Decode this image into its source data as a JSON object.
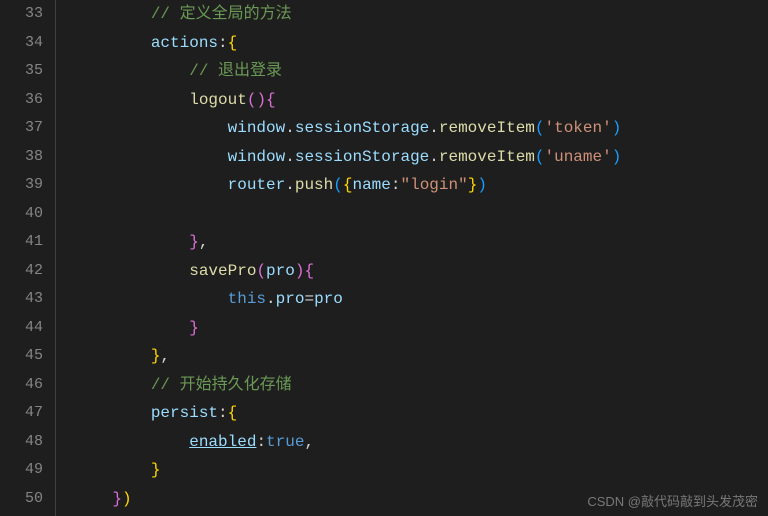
{
  "gutter": {
    "start": 33,
    "end": 50
  },
  "code": {
    "lines": [
      {
        "n": 33,
        "indent": "        ",
        "tokens": [
          {
            "t": "// 定义全局的方法",
            "c": "c-comment"
          }
        ]
      },
      {
        "n": 34,
        "indent": "        ",
        "tokens": [
          {
            "t": "actions",
            "c": "c-property"
          },
          {
            "t": ":",
            "c": "c-punct"
          },
          {
            "t": "{",
            "c": "c-brace"
          }
        ]
      },
      {
        "n": 35,
        "indent": "            ",
        "tokens": [
          {
            "t": "// 退出登录",
            "c": "c-comment"
          }
        ]
      },
      {
        "n": 36,
        "indent": "            ",
        "tokens": [
          {
            "t": "logout",
            "c": "c-function"
          },
          {
            "t": "(",
            "c": "c-brace2"
          },
          {
            "t": ")",
            "c": "c-brace2"
          },
          {
            "t": "{",
            "c": "c-brace2"
          }
        ]
      },
      {
        "n": 37,
        "indent": "                ",
        "tokens": [
          {
            "t": "window",
            "c": "c-variable"
          },
          {
            "t": ".",
            "c": "c-punct"
          },
          {
            "t": "sessionStorage",
            "c": "c-variable"
          },
          {
            "t": ".",
            "c": "c-punct"
          },
          {
            "t": "removeItem",
            "c": "c-function"
          },
          {
            "t": "(",
            "c": "c-brace3"
          },
          {
            "t": "'token'",
            "c": "c-string"
          },
          {
            "t": ")",
            "c": "c-brace3"
          }
        ]
      },
      {
        "n": 38,
        "indent": "                ",
        "tokens": [
          {
            "t": "window",
            "c": "c-variable"
          },
          {
            "t": ".",
            "c": "c-punct"
          },
          {
            "t": "sessionStorage",
            "c": "c-variable"
          },
          {
            "t": ".",
            "c": "c-punct"
          },
          {
            "t": "removeItem",
            "c": "c-function"
          },
          {
            "t": "(",
            "c": "c-brace3"
          },
          {
            "t": "'uname'",
            "c": "c-string"
          },
          {
            "t": ")",
            "c": "c-brace3"
          }
        ]
      },
      {
        "n": 39,
        "indent": "                ",
        "tokens": [
          {
            "t": "router",
            "c": "c-variable"
          },
          {
            "t": ".",
            "c": "c-punct"
          },
          {
            "t": "push",
            "c": "c-function"
          },
          {
            "t": "(",
            "c": "c-brace3"
          },
          {
            "t": "{",
            "c": "c-brace"
          },
          {
            "t": "name",
            "c": "c-property"
          },
          {
            "t": ":",
            "c": "c-punct"
          },
          {
            "t": "\"login\"",
            "c": "c-string"
          },
          {
            "t": "}",
            "c": "c-brace"
          },
          {
            "t": ")",
            "c": "c-brace3"
          }
        ]
      },
      {
        "n": 40,
        "indent": "",
        "tokens": []
      },
      {
        "n": 41,
        "indent": "            ",
        "tokens": [
          {
            "t": "}",
            "c": "c-brace2"
          },
          {
            "t": ",",
            "c": "c-punct"
          }
        ]
      },
      {
        "n": 42,
        "indent": "            ",
        "tokens": [
          {
            "t": "savePro",
            "c": "c-function"
          },
          {
            "t": "(",
            "c": "c-brace2"
          },
          {
            "t": "pro",
            "c": "c-variable"
          },
          {
            "t": ")",
            "c": "c-brace2"
          },
          {
            "t": "{",
            "c": "c-brace2"
          }
        ]
      },
      {
        "n": 43,
        "indent": "                ",
        "tokens": [
          {
            "t": "this",
            "c": "c-this"
          },
          {
            "t": ".",
            "c": "c-punct"
          },
          {
            "t": "pro",
            "c": "c-variable"
          },
          {
            "t": "=",
            "c": "c-punct"
          },
          {
            "t": "pro",
            "c": "c-variable"
          }
        ]
      },
      {
        "n": 44,
        "indent": "            ",
        "tokens": [
          {
            "t": "}",
            "c": "c-brace2"
          }
        ]
      },
      {
        "n": 45,
        "indent": "        ",
        "tokens": [
          {
            "t": "}",
            "c": "c-brace"
          },
          {
            "t": ",",
            "c": "c-punct"
          }
        ]
      },
      {
        "n": 46,
        "indent": "        ",
        "tokens": [
          {
            "t": "// 开始持久化存储",
            "c": "c-comment"
          }
        ]
      },
      {
        "n": 47,
        "indent": "        ",
        "tokens": [
          {
            "t": "persist",
            "c": "c-property"
          },
          {
            "t": ":",
            "c": "c-punct"
          },
          {
            "t": "{",
            "c": "c-brace"
          }
        ]
      },
      {
        "n": 48,
        "indent": "            ",
        "tokens": [
          {
            "t": "enabled",
            "c": "c-property underline"
          },
          {
            "t": ":",
            "c": "c-punct"
          },
          {
            "t": "true",
            "c": "c-bool"
          },
          {
            "t": ",",
            "c": "c-punct"
          }
        ]
      },
      {
        "n": 49,
        "indent": "        ",
        "tokens": [
          {
            "t": "}",
            "c": "c-brace"
          }
        ]
      },
      {
        "n": 50,
        "indent": "    ",
        "tokens": [
          {
            "t": "}",
            "c": "c-brace2"
          },
          {
            "t": ")",
            "c": "c-brace"
          }
        ]
      }
    ]
  },
  "watermark": "CSDN @敲代码敲到头发茂密"
}
